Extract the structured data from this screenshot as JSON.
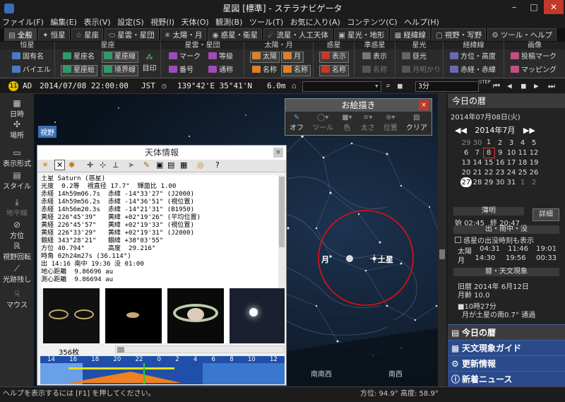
{
  "window": {
    "title": "星図 [標準] - ステラナビゲータ"
  },
  "menu": [
    "ファイル(F)",
    "編集(E)",
    "表示(V)",
    "設定(S)",
    "視野(I)",
    "天体(O)",
    "観測(B)",
    "ツール(T)",
    "お気に入り(A)",
    "コンテンツ(C)",
    "ヘルプ(H)"
  ],
  "tabs": [
    "全般",
    "恒星",
    "星座",
    "星雲・星団",
    "太陽・月",
    "惑星・衛星",
    "流星・人工天体",
    "星光・地形",
    "経緯線",
    "視野・写野",
    "ツール・ヘルプ"
  ],
  "ribbon": {
    "groups": [
      "恒星",
      "星座",
      "星雲・星団",
      "太陽・月",
      "惑星",
      "準惑星",
      "星光",
      "経緯線",
      "画像"
    ],
    "star": [
      "固有名",
      "バイエル"
    ],
    "constellation": [
      "星座名",
      "星座線",
      "星座絵",
      "境界線",
      "目印"
    ],
    "nebula": [
      "マーク",
      "等級",
      "番号",
      "通称"
    ],
    "sunmoon": [
      "太陽",
      "月",
      "名称",
      "名称"
    ],
    "planet": [
      "表示",
      "名称"
    ],
    "dwarf": [
      "表示",
      "名称"
    ],
    "light": [
      "昼光",
      "月明かり"
    ],
    "grid": [
      "方位・高度",
      "赤経・赤緯"
    ],
    "image": [
      "投稿マーク",
      "マッピング"
    ]
  },
  "timebar": {
    "mode": "AD",
    "datetime": "2014/07/08 22:00:00",
    "tz": "JST",
    "position": "139°42'E 35°41'N",
    "altitude": "6.0m",
    "step": "3分",
    "step_label": "STEP"
  },
  "left": [
    "日時",
    "場所",
    "表示形式",
    "スタイル",
    "地平線",
    "方位",
    "視野回転",
    "光跡残し",
    "マウス"
  ],
  "sky": {
    "moon_label": "月",
    "saturn_label": "土星",
    "field_badge": "視野",
    "dir1": "南南西",
    "dir2": "南西"
  },
  "paint": {
    "title": "お絵描き",
    "tools": [
      "オフ",
      "ツール",
      "色",
      "太さ",
      "位置",
      "クリア"
    ]
  },
  "info": {
    "title": "天体情報",
    "text": "土星 Saturn (惑星)\n光度  0.2等  視直径 17.7\"  輝面比 1.00\n赤経 14h59m06.7s  赤緯 -14°33'27\" (J2000)\n赤経 14h59m56.2s  赤緯 -14°36'51\" (視位置)\n赤経 14h56m20.3s  赤緯 -14°21'31\" (B1950)\n黄経 226°45'39\"   黄緯 +02°19'26\" (平均位置)\n黄経 226°45'57\"   黄緯 +02°19'33\" (視位置)\n黄経 226°33'29\"   黄緯 +02°19'31\" (J2000)\n銀経 343°28'21\"   銀緯 +38°03'55\"\n方位 40.794°      高度  29.216°\n時角 02h24m27s (36.114°)\n出 14:16 南中 19:36 没 01:00\n地心距離  9.86696 au\n測心距離  9.86694 au",
    "count": "356枚",
    "hours": [
      "14",
      "16",
      "18",
      "20",
      "22",
      "0",
      "2",
      "4",
      "6",
      "8",
      "10",
      "12"
    ]
  },
  "right": {
    "header": "今日の暦",
    "date": "2014年07月08日(火)",
    "month": "2014年7月",
    "weekrow1": [
      "29",
      "30",
      "1",
      "2",
      "3",
      "4",
      "5"
    ],
    "weekrow2": [
      "6",
      "7",
      "8",
      "9",
      "10",
      "11",
      "12"
    ],
    "weekrow3": [
      "13",
      "14",
      "15",
      "16",
      "17",
      "18",
      "19"
    ],
    "weekrow4": [
      "20",
      "21",
      "22",
      "23",
      "24",
      "25",
      "26"
    ],
    "weekrow5": [
      "27",
      "28",
      "29",
      "30",
      "31",
      "1",
      "2"
    ],
    "twilight": "薄明",
    "twi_start": "始 02:45",
    "twi_end": "終 20:47",
    "detail": "詳細",
    "rise_header": "出・南中・没",
    "planet_opt": "惑星の出没時刻も表示",
    "sun": [
      "太陽",
      "04:31",
      "11:46",
      "19:01"
    ],
    "moon": [
      "月",
      "14:30",
      "19:56",
      "00:33"
    ],
    "phen_header": "暦・天文現象",
    "lunar": "旧暦 2014年 6月12日",
    "age": "月齢 10.0",
    "event_time": "■10時27分",
    "event": "月が土星の南0.7° 通過",
    "nav": [
      "今日の暦",
      "天文現象ガイド",
      "更新情報",
      "新着ニュース"
    ]
  },
  "status": {
    "help": "ヘルプを表示するには [F1] を押してください。",
    "az": "方位: 94.9° 高度: 58.9°"
  }
}
